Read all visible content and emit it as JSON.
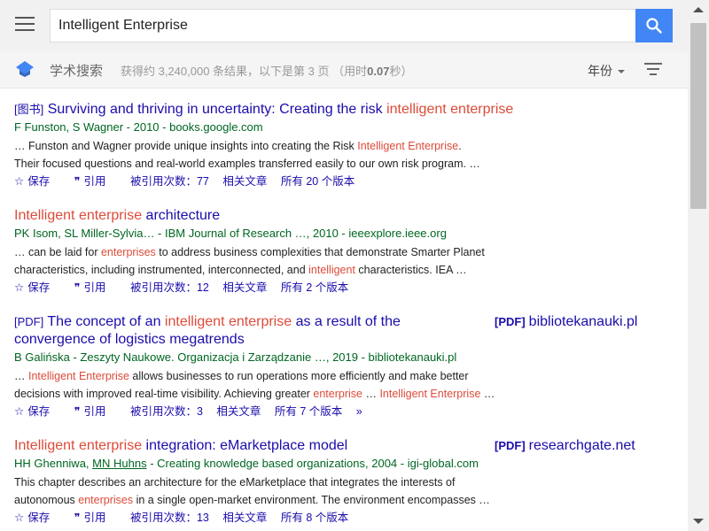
{
  "search": {
    "query": "Intelligent Enterprise"
  },
  "brand": "学术搜索",
  "stats": {
    "prefix": "获得约 3,240,000 条结果，以下是第 3 页 （用时",
    "time": "0.07",
    "suffix": "秒）"
  },
  "filters": {
    "year_label": "年份"
  },
  "colors": {
    "accent": "#4285f4",
    "link": "#1a0dab",
    "highlight": "#dd4b39",
    "author": "#006621"
  },
  "results": [
    {
      "tag": "[图书]",
      "title_parts": [
        "Surviving and thriving in uncertainty: Creating the risk ",
        "intelligent enterprise"
      ],
      "authors": "F Funston, S Wagner - 2010 - books.google.com",
      "snippet_lines": [
        [
          "… Funston and Wagner provide unique insights into creating the Risk ",
          "Intelligent Enterprise",
          "."
        ],
        [
          "Their focused questions and real-world examples transferred easily to our own risk program. …"
        ]
      ],
      "actions": {
        "save": "保存",
        "cite": "引用",
        "cited": "被引用次数：77",
        "related": "相关文章",
        "versions": "所有 20 个版本"
      }
    },
    {
      "title_parts": [
        "Intelligent enterprise",
        " architecture"
      ],
      "authors": "PK Isom, SL Miller-Sylvia… - IBM Journal of Research …, 2010 - ieeexplore.ieee.org",
      "snippet_lines": [
        [
          "… can be laid for ",
          "enterprises",
          " to address business complexities that demonstrate Smarter Planet"
        ],
        [
          "characteristics, including instrumented, interconnected, and ",
          "intelligent",
          " characteristics. IEA …"
        ]
      ],
      "actions": {
        "save": "保存",
        "cite": "引用",
        "cited": "被引用次数：12",
        "related": "相关文章",
        "versions": "所有 2 个版本"
      }
    },
    {
      "tag": "[PDF]",
      "title_parts": [
        "The concept of an ",
        "intelligent enterprise",
        " as a result of the"
      ],
      "title_line2": "convergence of logistics megatrends",
      "authors": "B Galińska - Zeszyty Naukowe. Organizacja i Zarządzanie …, 2019 - bibliotekanauki.pl",
      "snippet_lines": [
        [
          "… ",
          "Intelligent Enterprise",
          " allows businesses to run operations more efficiently and make better"
        ],
        [
          "decisions with improved real-time visibility. Achieving greater ",
          "enterprise",
          " … ",
          "Intelligent Enterprise",
          " …"
        ]
      ],
      "side": {
        "tag": "[PDF]",
        "domain": "bibliotekanauki.pl"
      },
      "actions": {
        "save": "保存",
        "cite": "引用",
        "cited": "被引用次数：3",
        "related": "相关文章",
        "versions": "所有 7 个版本",
        "more": "»"
      }
    },
    {
      "title_parts": [
        "Intelligent enterprise",
        " integration: eMarketplace model"
      ],
      "authors_a": "HH Ghenniwa, ",
      "authors_link": "MN Huhns",
      "authors_b": " - Creating knowledge based organizations, 2004 - igi-global.com",
      "snippet_lines": [
        [
          "This chapter describes an architecture for the eMarketplace that integrates the interests of"
        ],
        [
          "autonomous ",
          "enterprises",
          " in a single open-market environment. The environment encompasses …"
        ]
      ],
      "side": {
        "tag": "[PDF]",
        "domain": "researchgate.net"
      },
      "actions": {
        "save": "保存",
        "cite": "引用",
        "cited": "被引用次数：13",
        "related": "相关文章",
        "versions": "所有 8 个版本"
      }
    }
  ]
}
